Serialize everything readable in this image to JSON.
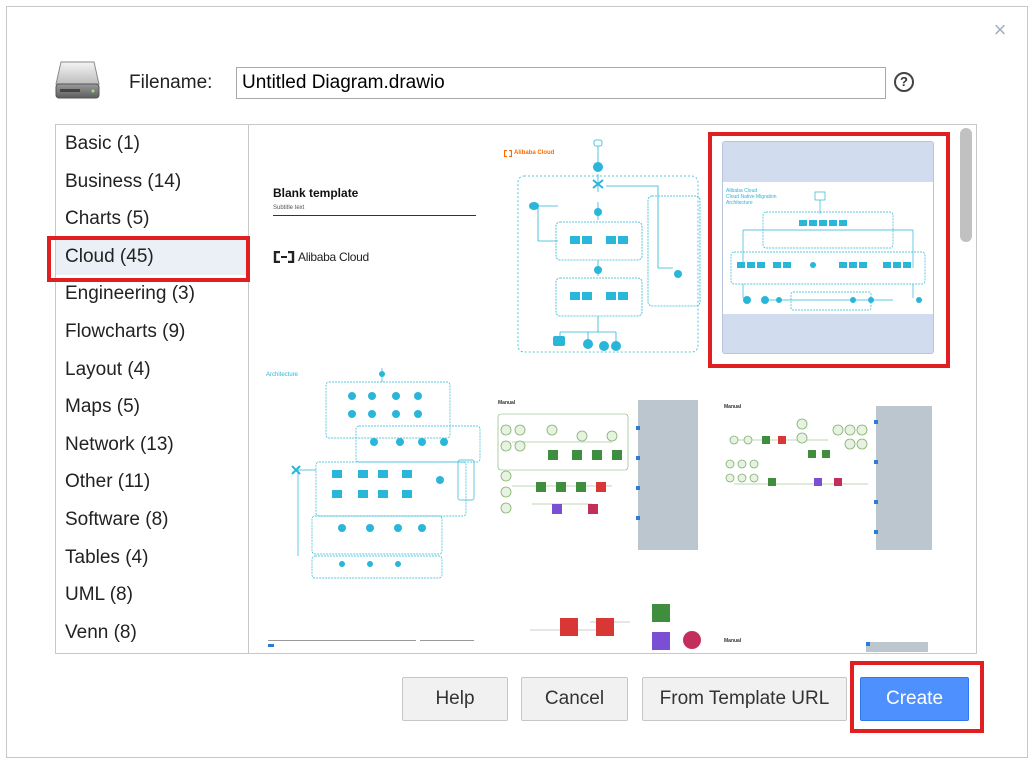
{
  "dialog": {
    "filename_label": "Filename:",
    "filename_value": "Untitled Diagram.drawio",
    "help_icon_glyph": "?",
    "close_glyph": "×"
  },
  "categories": [
    {
      "label": "Basic (1)"
    },
    {
      "label": "Business (14)"
    },
    {
      "label": "Charts (5)"
    },
    {
      "label": "Cloud (45)",
      "selected": true
    },
    {
      "label": "Engineering (3)"
    },
    {
      "label": "Flowcharts (9)"
    },
    {
      "label": "Layout (4)"
    },
    {
      "label": "Maps (5)"
    },
    {
      "label": "Network (13)"
    },
    {
      "label": "Other (11)"
    },
    {
      "label": "Software (8)"
    },
    {
      "label": "Tables (4)"
    },
    {
      "label": "UML (8)"
    },
    {
      "label": "Venn (8)"
    }
  ],
  "templates": {
    "blank": {
      "title": "Blank template",
      "subtitle": "Subtitle text",
      "logo_text": "Alibaba Cloud"
    },
    "alibaba_brand": "Alibaba Cloud",
    "migration_title": "Alibaba Cloud\nCloud Native Migration\nArchitecture",
    "architecture_label": "Architecture",
    "manual_label": "Manual"
  },
  "buttons": {
    "help": "Help",
    "cancel": "Cancel",
    "from_template_url": "From Template URL",
    "create": "Create"
  },
  "colors": {
    "accent_red": "#e02020",
    "primary_blue": "#4d90fe",
    "cyan_diagram": "#29b6d8",
    "orange_brand": "#ff6a00"
  },
  "icons": {
    "disk": "hard-disk-icon",
    "help": "question-circle-icon",
    "close": "close-icon"
  }
}
